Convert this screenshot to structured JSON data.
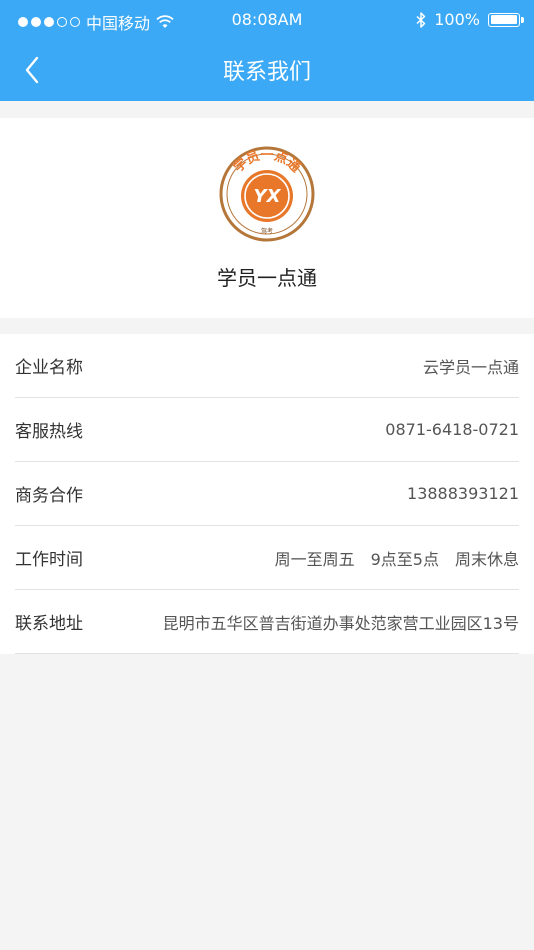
{
  "status_bar": {
    "carrier": "中国移动",
    "time": "08:08AM",
    "battery": "100%"
  },
  "nav": {
    "title": "联系我们",
    "back_icon": "chevron-left-icon"
  },
  "brand": {
    "name": "学员一点通",
    "logo_text": "学员一点通",
    "logo_initials": "YX",
    "logo_small": "驾考"
  },
  "info": {
    "rows": [
      {
        "label": "企业名称",
        "value": "云学员一点通"
      },
      {
        "label": "客服热线",
        "value": "0871-6418-0721"
      },
      {
        "label": "商务合作",
        "value": "13888393121"
      },
      {
        "label": "工作时间",
        "value": "周一至周五　9点至5点　周末休息"
      },
      {
        "label": "联系地址",
        "value": "昆明市五华区普吉街道办事处范家营工业园区13号"
      }
    ]
  },
  "colors": {
    "header": "#3ba9f5",
    "logo_orange": "#e8772a",
    "logo_brown": "#b5763a"
  }
}
